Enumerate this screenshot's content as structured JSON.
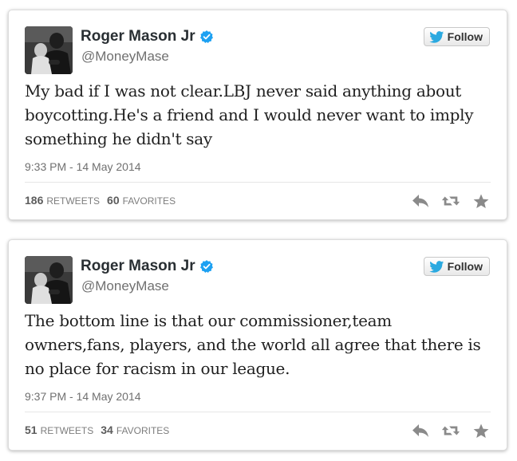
{
  "colors": {
    "verified_badge": "#1da1f2",
    "follow_bird": "#2aa9e0",
    "action_icon": "#8a8a8a"
  },
  "tweets": [
    {
      "author": {
        "name": "Roger Mason Jr",
        "handle": "@MoneyMase",
        "verified": true
      },
      "follow_label": "Follow",
      "text": "My bad if I was not clear.LBJ never said anything about boycotting.He's a friend and I would never want to imply something he didn't say",
      "timestamp": "9:33 PM - 14 May 2014",
      "retweets": "186",
      "retweets_label": "RETWEETS",
      "favorites": "60",
      "favorites_label": "FAVORITES",
      "actions": [
        "reply-icon",
        "retweet-icon",
        "favorite-icon"
      ]
    },
    {
      "author": {
        "name": "Roger Mason Jr",
        "handle": "@MoneyMase",
        "verified": true
      },
      "follow_label": "Follow",
      "text": "The bottom line is that our commissioner,team owners,fans, players, and the world all agree that there is no place for racism in our league.",
      "timestamp": "9:37 PM - 14 May 2014",
      "retweets": "51",
      "retweets_label": "RETWEETS",
      "favorites": "34",
      "favorites_label": "FAVORITES",
      "actions": [
        "reply-icon",
        "retweet-icon",
        "favorite-icon"
      ]
    }
  ]
}
